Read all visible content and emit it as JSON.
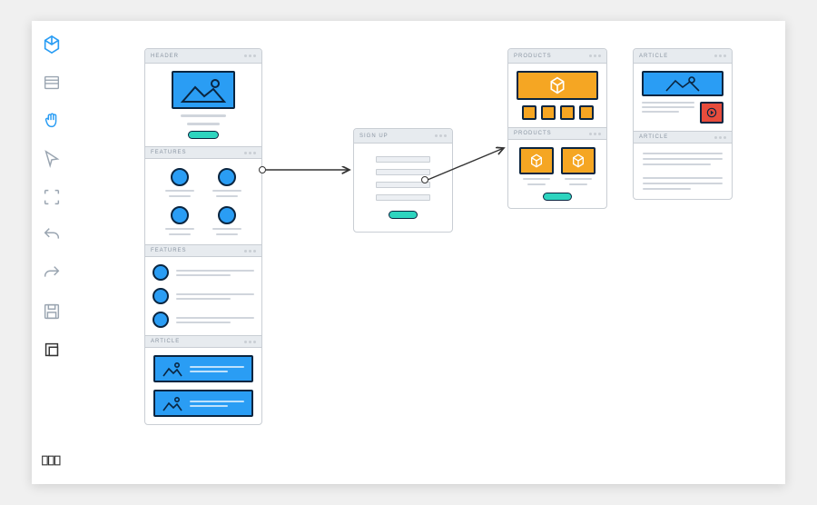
{
  "toolbar": {
    "tools": [
      {
        "name": "assets-icon"
      },
      {
        "name": "wireframe-icon"
      },
      {
        "name": "hand-icon"
      },
      {
        "name": "pointer-icon"
      },
      {
        "name": "frame-icon"
      },
      {
        "name": "undo-icon"
      },
      {
        "name": "redo-icon"
      },
      {
        "name": "save-icon"
      },
      {
        "name": "artboard-icon"
      }
    ],
    "footer_tool": {
      "name": "inspect-icon"
    }
  },
  "canvas": {
    "frames": {
      "main": {
        "sections": {
          "header": {
            "title": "HEADER"
          },
          "features1": {
            "title": "FEATURES"
          },
          "features2": {
            "title": "FEATURES"
          },
          "article": {
            "title": "ARTICLE"
          }
        }
      },
      "signup": {
        "title": "SIGN UP"
      },
      "products": {
        "section1": "PRODUCTS",
        "section2": "PRODUCTS"
      },
      "article_frame": {
        "section1": "ARTICLE",
        "section2": "ARTICLE"
      }
    }
  },
  "colors": {
    "blue": "#2a9df4",
    "orange": "#f5a623",
    "teal": "#2dd4bf",
    "red": "#e74c3c",
    "dark": "#0a2540"
  }
}
